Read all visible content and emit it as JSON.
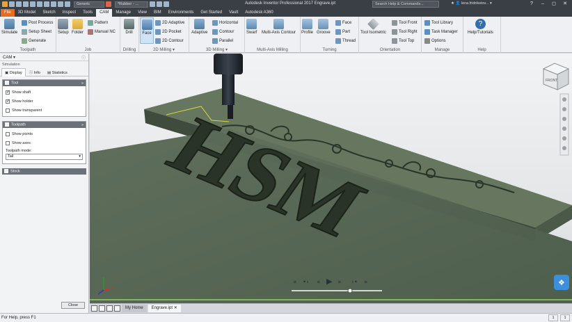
{
  "titlebar": {
    "file_combo": "Generic",
    "doc_combo": "*Rubber - …",
    "app_title": "Autodesk Inventor Professional 2017   Engrave.ipt",
    "search_placeholder": "Search Help & Commands...",
    "user": "lena.fridrikstov..."
  },
  "tabs": [
    "File",
    "3D Model",
    "Sketch",
    "Inspect",
    "Tools",
    "CAM",
    "Manage",
    "View",
    "BIM",
    "Environments",
    "Get Started",
    "Vault",
    "Autodesk A360"
  ],
  "active_tab": "CAM",
  "ribbon": {
    "toolpath": {
      "label": "Toolpath",
      "simulate": "Simulate",
      "post_process": "Post Process",
      "setup_sheet": "Setup Sheet",
      "generate": "Generate"
    },
    "job": {
      "label": "Job",
      "setup": "Setup",
      "folder": "Folder",
      "pattern": "Pattern",
      "manual_nc": "Manual NC"
    },
    "drilling": {
      "label": "Drilling",
      "drill": "Drill"
    },
    "milling2d": {
      "label": "2D Milling",
      "face": "Face",
      "adaptive": "2D Adaptive",
      "pocket": "2D Pocket",
      "contour": "2D Contour"
    },
    "milling3d": {
      "label": "3D Milling",
      "adaptive": "Adaptive",
      "horizontal": "Horizontal",
      "contour": "Contour",
      "parallel": "Parallel"
    },
    "multiaxis": {
      "label": "Multi-Axis Milling",
      "swarf": "Swarf",
      "multiaxis_contour": "Multi-Axis Contour"
    },
    "turning": {
      "label": "Turning",
      "profile": "Profile",
      "groove": "Groove",
      "face": "Face",
      "part": "Part",
      "thread": "Thread"
    },
    "orientation": {
      "label": "Orientation",
      "tool_isometric": "Tool Isometric",
      "tool_front": "Tool Front",
      "tool_right": "Tool Right",
      "tool_top": "Tool Top"
    },
    "manage": {
      "label": "Manage",
      "tool_library": "Tool Library",
      "task_manager": "Task Manager",
      "options": "Options"
    },
    "help": {
      "label": "Help",
      "help_tutorials": "Help/Tutorials"
    }
  },
  "browser": {
    "title": "CAM",
    "section": "Simulation",
    "subtabs": [
      "Display",
      "Info",
      "Statistics"
    ],
    "tool_group": {
      "title": "Tool",
      "show_shaft": "Show shaft",
      "show_holder": "Show holder",
      "show_transparent": "Show transparent"
    },
    "toolpath_group": {
      "title": "Toolpath",
      "show_points": "Show points",
      "show_axes": "Show axes",
      "mode_label": "Toolpath mode:",
      "mode_value": "Tail"
    },
    "stock_group": {
      "title": "Stock"
    },
    "close_label": "Close"
  },
  "viewport": {
    "engraved_text": "HSM",
    "viewcube_label": "FRONT"
  },
  "doc_tabs": [
    "My Home",
    "Engrave.ipt"
  ],
  "status": {
    "text": "For Help, press F1",
    "box1": "1",
    "box2": "1"
  },
  "colors": {
    "accent": "#ec6b1a",
    "stock": "#586a58",
    "ribbon": "#eef0f3"
  }
}
